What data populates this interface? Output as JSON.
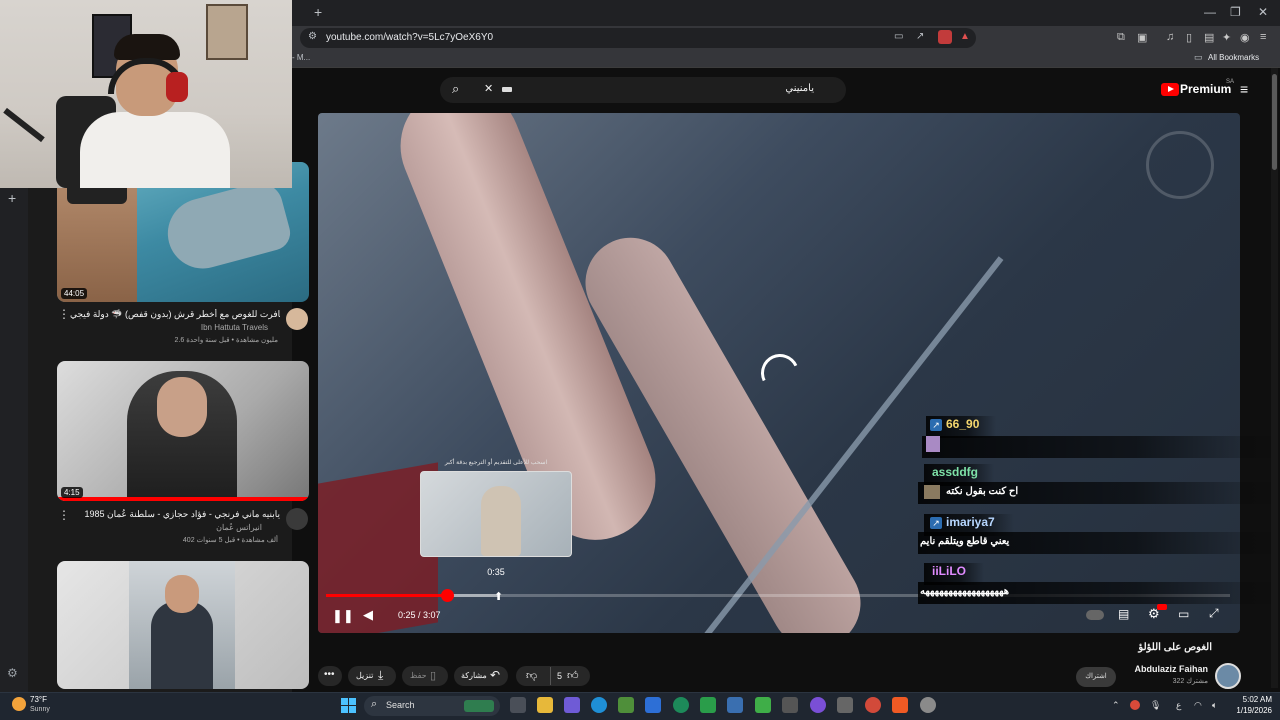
{
  "browser": {
    "url": "youtube.com/watch?v=5Lc7yOeX6Y0",
    "bookmarks_left": "- M...",
    "bookmarks_right": "All Bookmarks"
  },
  "youtube": {
    "search_query": "يامنيني",
    "premium_label": "Premium",
    "premium_region": "SA"
  },
  "sidebar": {
    "videos": [
      {
        "title": "سافرت للغوص مع أخطر قرش (بدون قفص) 🦈 دولة فيجي ...",
        "channel": "Ibn Hattuta Travels",
        "meta": "2.6 مليون مشاهدة • قبل سنة واحدة",
        "duration": "44:05"
      },
      {
        "title": "يابنيه ماني فرنجي - فؤاد حجازي - سلطنة عُمان 1985",
        "channel": "انيراتس عُمان",
        "meta": "402 ألف مشاهدة • قبل 5 سنوات",
        "duration": "4:15"
      },
      {
        "title": "",
        "channel": "",
        "meta": "",
        "duration": ""
      }
    ]
  },
  "player": {
    "current_time": "0:25",
    "total_time": "3:07",
    "time_display": "0:25 / 3:07",
    "preview_time": "0:35",
    "preview_hint": "اسحب للأعلى للتقديم أو الترجيع بدقة أكبر",
    "played_fraction": 0.134,
    "buffered_fraction": 0.19
  },
  "chat": [
    {
      "user": "66_90",
      "color": "#f5d76e",
      "message": "",
      "badge": true
    },
    {
      "user": "assddfg",
      "color": "#7ee2a8",
      "message": "اح كنت بقول نكته",
      "badge": false
    },
    {
      "user": "imariya7",
      "color": "#b7d7ff",
      "message": "يعني قاطع ويتلقم نايم",
      "badge": true
    },
    {
      "user": "iiLiLO",
      "color": "#e08bff",
      "message": "ههههههههههههههههههه",
      "badge": false
    }
  ],
  "below_video": {
    "title": "الغوص على اللؤلؤ",
    "channel": "Abdulaziz Faihan",
    "subscribers": "322 مشترك",
    "subscribe_label": "اشتراك",
    "likes": "5",
    "share_label": "مشاركة",
    "save_label": "حفظ",
    "download_label": "تنزيل"
  },
  "taskbar": {
    "temperature": "73°F",
    "condition": "Sunny",
    "search_label": "Search",
    "time": "5:02 AM",
    "date": "1/19/2026"
  }
}
